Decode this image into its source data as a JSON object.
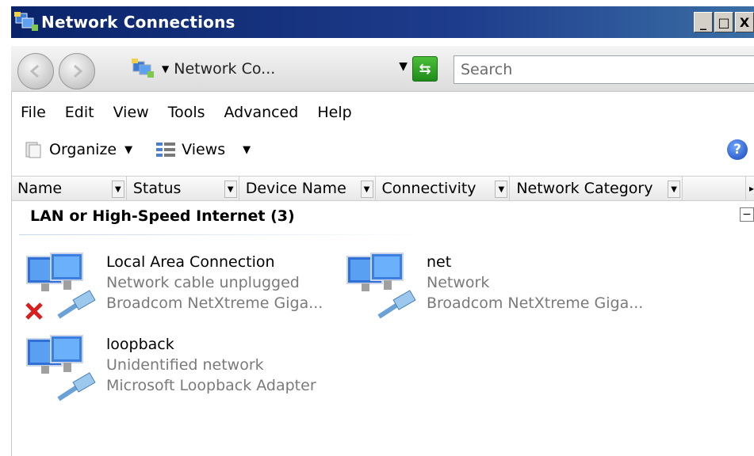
{
  "window": {
    "title": "Network Connections",
    "controls": [
      "_",
      "□",
      "X"
    ]
  },
  "navbar": {
    "address_text": "Network Co...",
    "search_placeholder": "Search"
  },
  "menu": [
    "File",
    "Edit",
    "View",
    "Tools",
    "Advanced",
    "Help"
  ],
  "toolbar": {
    "organize_label": "Organize",
    "views_label": "Views"
  },
  "columns": [
    "Name",
    "Status",
    "Device Name",
    "Connectivity",
    "Network Category"
  ],
  "group": {
    "title": "LAN or High-Speed Internet (3)"
  },
  "connections": [
    {
      "name": "Local Area Connection",
      "status": "Network cable unplugged",
      "device": "Broadcom NetXtreme Giga...",
      "disconnected": true
    },
    {
      "name": "net",
      "status": "Network",
      "device": "Broadcom NetXtreme Giga...",
      "disconnected": false
    },
    {
      "name": "loopback",
      "status": "Unidentified network",
      "device": "Microsoft Loopback Adapter",
      "disconnected": false
    }
  ]
}
